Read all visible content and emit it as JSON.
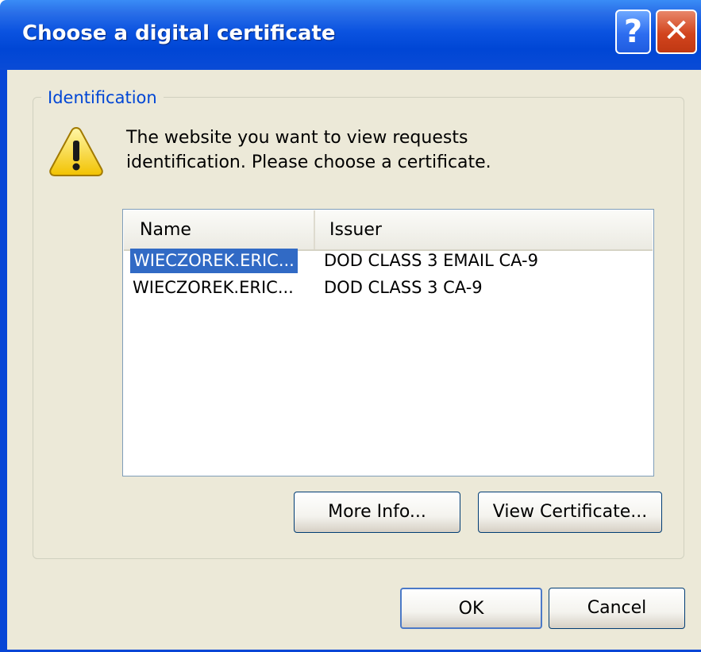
{
  "dialog": {
    "title": "Choose a digital certificate",
    "help_glyph": "?",
    "close_glyph": "✕"
  },
  "group": {
    "legend": "Identification",
    "icon": "warning-icon",
    "message_line1": "The website you want to view requests",
    "message_line2": "identification. Please choose a certificate."
  },
  "list": {
    "columns": [
      "Name",
      "Issuer"
    ],
    "rows": [
      {
        "name": "WIECZOREK.ERIC...",
        "issuer": "DOD CLASS 3 EMAIL CA-9",
        "selected": true
      },
      {
        "name": "WIECZOREK.ERIC...",
        "issuer": "DOD CLASS 3 CA-9",
        "selected": false
      }
    ]
  },
  "buttons": {
    "more_info": "More Info...",
    "view_certificate": "View Certificate...",
    "ok": "OK",
    "cancel": "Cancel"
  },
  "colors": {
    "titlebar": "#0046d5",
    "selection": "#316ac5",
    "legend_text": "#0046d5",
    "dialog_face": "#ece9d8"
  }
}
